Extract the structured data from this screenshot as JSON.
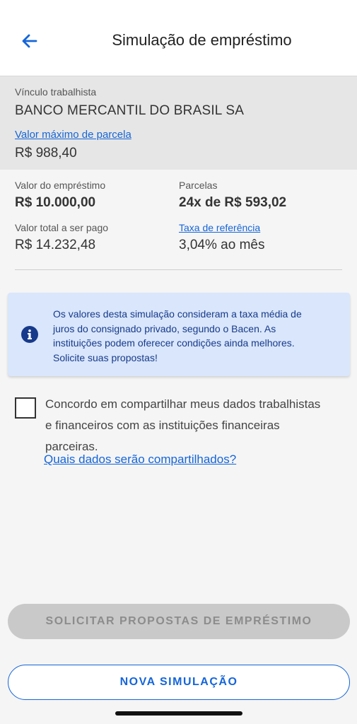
{
  "header": {
    "title": "Simulação de empréstimo",
    "back_icon": "arrow-left-icon"
  },
  "employer": {
    "label": "Vínculo trabalhista",
    "name": "BANCO MERCANTIL DO BRASIL SA",
    "max_installment_link": "Valor máximo de parcela",
    "max_installment_value": "R$ 988,40"
  },
  "summary": {
    "loan_label": "Valor do empréstimo",
    "loan_value": "R$ 10.000,00",
    "installments_label": "Parcelas",
    "installments_value": "24x de R$ 593,02",
    "total_label": "Valor total a ser pago",
    "total_value": "R$ 14.232,48",
    "rate_label": "Taxa de referência",
    "rate_value": "3,04% ao mês"
  },
  "info": {
    "icon": "info-icon",
    "text": "Os valores desta simulação consideram a taxa média de juros do consignado privado, segundo o Bacen. As instituições podem oferecer condições ainda melhores. Solicite suas propostas!"
  },
  "consent": {
    "checked": false,
    "text": "Concordo em compartilhar meus dados trabalhistas e financeiros com as instituições financeiras parceiras.",
    "link": "Quais dados serão compartilhados?"
  },
  "buttons": {
    "request": "SOLICITAR PROPOSTAS DE EMPRÉSTIMO",
    "new_simulation": "NOVA SIMULAÇÃO"
  },
  "colors": {
    "accent": "#1565d8",
    "info_bg": "#d9e6fb",
    "info_text": "#173a8a",
    "disabled_bg": "#c9c9c9"
  }
}
